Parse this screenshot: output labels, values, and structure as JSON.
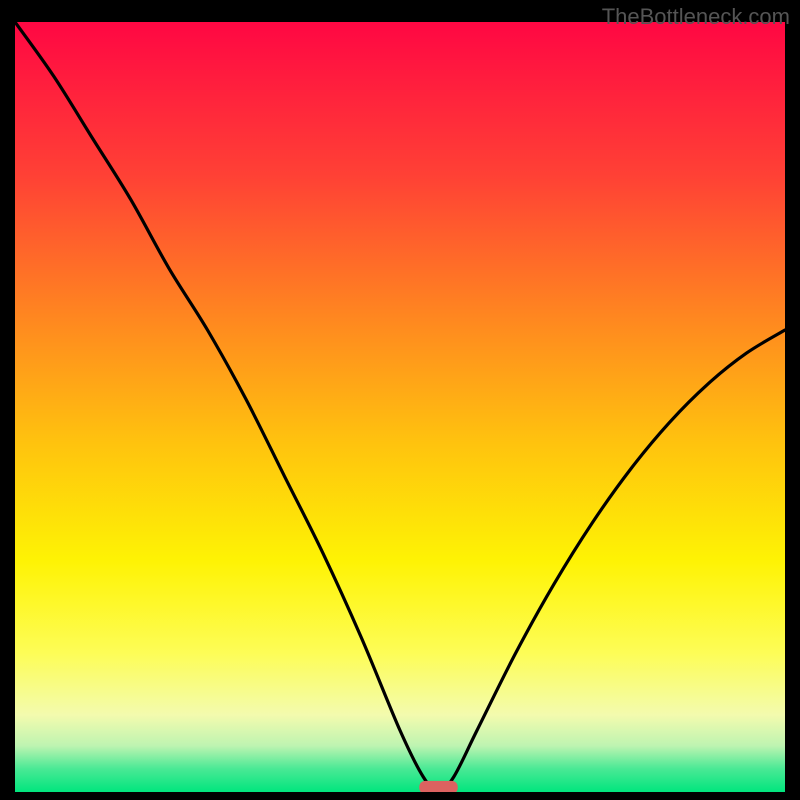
{
  "watermark": "TheBottleneck.com",
  "chart_data": {
    "type": "line",
    "title": "",
    "xlabel": "",
    "ylabel": "",
    "xlim": [
      0,
      100
    ],
    "ylim": [
      0,
      100
    ],
    "grid": false,
    "x": [
      0,
      5,
      10,
      15,
      20,
      25,
      30,
      35,
      40,
      45,
      50,
      53,
      55,
      57,
      60,
      65,
      70,
      75,
      80,
      85,
      90,
      95,
      100
    ],
    "values": [
      100,
      93,
      85,
      77,
      68,
      60,
      51,
      41,
      31,
      20,
      8,
      2,
      0,
      2,
      8,
      18,
      27,
      35,
      42,
      48,
      53,
      57,
      60
    ],
    "marker": {
      "x_start": 52.5,
      "x_end": 57.5,
      "y": 0.6,
      "color": "#dc6260"
    },
    "background_gradient": {
      "stops": [
        {
          "offset": 0.0,
          "color": "#ff0743"
        },
        {
          "offset": 0.2,
          "color": "#ff4135"
        },
        {
          "offset": 0.4,
          "color": "#ff8d1e"
        },
        {
          "offset": 0.55,
          "color": "#ffc40e"
        },
        {
          "offset": 0.7,
          "color": "#fef304"
        },
        {
          "offset": 0.82,
          "color": "#fdfd57"
        },
        {
          "offset": 0.9,
          "color": "#f3fbae"
        },
        {
          "offset": 0.94,
          "color": "#bef4b1"
        },
        {
          "offset": 0.97,
          "color": "#49e995"
        },
        {
          "offset": 1.0,
          "color": "#01e57e"
        }
      ]
    },
    "curve_color": "#000000",
    "curve_width": 3.2
  }
}
